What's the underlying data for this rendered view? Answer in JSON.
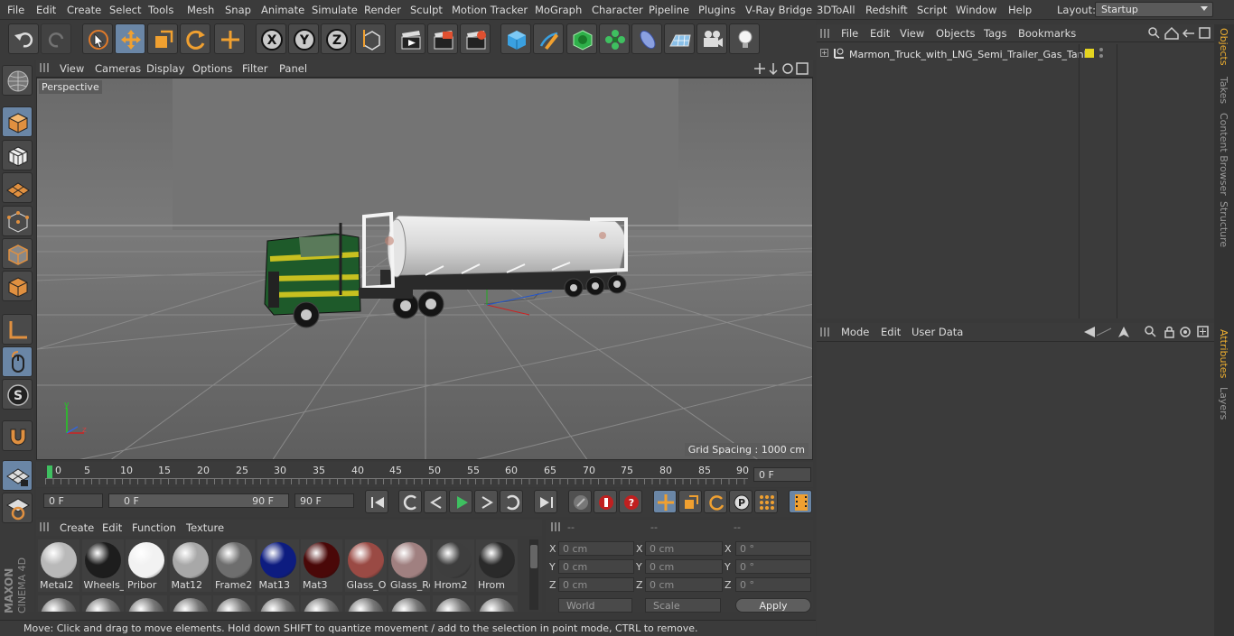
{
  "menu": {
    "items": [
      "File",
      "Edit",
      "Create",
      "Select",
      "Tools",
      "Mesh",
      "Snap",
      "Animate",
      "Simulate",
      "Render",
      "Sculpt",
      "Motion Tracker",
      "MoGraph",
      "Character",
      "Pipeline",
      "Plugins",
      "V-Ray Bridge",
      "3DToAll",
      "Redshift",
      "Script",
      "Window",
      "Help"
    ],
    "layout_label": "Layout:",
    "layout_value": "Startup"
  },
  "viewport": {
    "menu": [
      "View",
      "Cameras",
      "Display",
      "Options",
      "Filter",
      "Panel"
    ],
    "label": "Perspective",
    "grid_spacing": "Grid Spacing : 1000 cm"
  },
  "timeline": {
    "ticks": [
      "0",
      "5",
      "10",
      "15",
      "20",
      "25",
      "30",
      "35",
      "40",
      "45",
      "50",
      "55",
      "60",
      "65",
      "70",
      "75",
      "80",
      "85",
      "90"
    ],
    "current_frame": "0 F",
    "start_field": "0 F",
    "range_start": "0 F",
    "range_end": "90 F",
    "end_field": "90 F"
  },
  "materials": {
    "menu": [
      "Create",
      "Edit",
      "Function",
      "Texture"
    ],
    "items": [
      {
        "name": "Metal2",
        "color": "#b9b9b9"
      },
      {
        "name": "Wheels_",
        "color": "#1d1d1d"
      },
      {
        "name": "Pribor",
        "color": "#f2f2f2"
      },
      {
        "name": "Mat12",
        "color": "#a8a8a8"
      },
      {
        "name": "Frame2",
        "color": "#6e6e6e"
      },
      {
        "name": "Mat13",
        "color": "#0d1c80"
      },
      {
        "name": "Mat3",
        "color": "#4a0808"
      },
      {
        "name": "Glass_O",
        "color": "#9a4a44"
      },
      {
        "name": "Glass_Re",
        "color": "#a08080"
      },
      {
        "name": "Hrom2",
        "color": "#3e3e3e"
      },
      {
        "name": "Hrom",
        "color": "#2a2a2a"
      }
    ]
  },
  "coords": {
    "headers": [
      "--",
      "--",
      "--"
    ],
    "rows": [
      {
        "a": "X",
        "av": "0 cm",
        "b": "X",
        "bv": "0 cm",
        "c": "X",
        "cv": "0 °"
      },
      {
        "a": "Y",
        "av": "0 cm",
        "b": "Y",
        "bv": "0 cm",
        "c": "Y",
        "cv": "0 °"
      },
      {
        "a": "Z",
        "av": "0 cm",
        "b": "Z",
        "bv": "0 cm",
        "c": "Z",
        "cv": "0 °"
      }
    ],
    "world": "World",
    "scale": "Scale",
    "apply": "Apply"
  },
  "status": "Move: Click and drag to move elements. Hold down SHIFT to quantize movement / add to the selection in point mode, CTRL to remove.",
  "object_manager": {
    "menu": [
      "File",
      "Edit",
      "View",
      "Objects",
      "Tags",
      "Bookmarks"
    ],
    "object_name": "Marmon_Truck_with_LNG_Semi_Trailer_Gas_Tank"
  },
  "attributes": {
    "menu": [
      "Mode",
      "Edit",
      "User Data"
    ]
  },
  "side_tabs": [
    "Objects",
    "Takes",
    "Content Browser",
    "Structure",
    "Attributes",
    "Layers"
  ],
  "brand": {
    "maxon": "MAXON",
    "cinema": "CINEMA 4D"
  }
}
